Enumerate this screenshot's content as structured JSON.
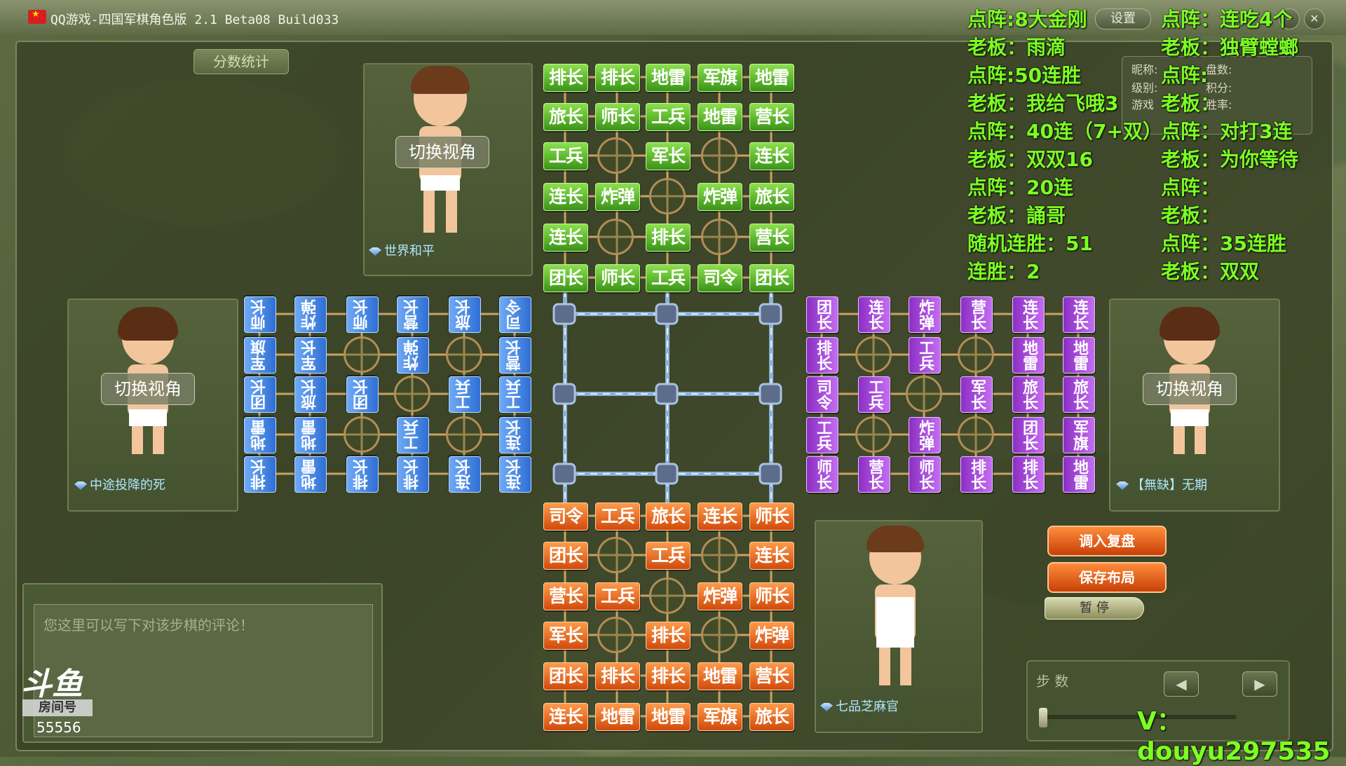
{
  "window": {
    "title": "QQ游戏-四国军棋角色版 2.1 Beta08 Build033",
    "settings_label": "设置",
    "minimize": "–",
    "close": "✕"
  },
  "score_button": "分数统计",
  "switch_label": "切换视角",
  "players": {
    "top": "世界和平",
    "left": "中途投降的死",
    "right": "【無缺】无期",
    "bottom": "七品芝麻官"
  },
  "stats_labels": {
    "nickname": "昵称:",
    "level": "级别:",
    "games": "游戏",
    "rounds": "盘数:",
    "points": "积分:",
    "winrate": "胜率:"
  },
  "overlay_left": [
    "点阵:8大金刚",
    "老板：雨滴",
    "点阵:50连胜",
    "老板：我给飞哦3",
    "点阵：40连（7+双）",
    "老板：双双16",
    "点阵：20连",
    "老板：誦哥",
    "随机连胜：51",
    "连胜：2"
  ],
  "overlay_right": [
    "点阵：连吃4个",
    "老板：独臂螳螂",
    "点阵:",
    "老板：",
    "点阵：对打3连",
    "老板：为你等待",
    "点阵：",
    "老板：",
    "点阵：35连胜",
    "老板：双双"
  ],
  "top_pieces": [
    [
      "排长",
      "排长",
      "地雷",
      "军旗",
      "地雷"
    ],
    [
      "旅长",
      "师长",
      "工兵",
      "地雷",
      "营长"
    ],
    [
      "工兵",
      "",
      "军长",
      "",
      "连长"
    ],
    [
      "连长",
      "炸弹",
      "",
      "炸弹",
      "旅长"
    ],
    [
      "连长",
      "",
      "排长",
      "",
      "营长"
    ],
    [
      "团长",
      "师长",
      "工兵",
      "司令",
      "团长"
    ]
  ],
  "bottom_pieces": [
    [
      "司令",
      "工兵",
      "旅长",
      "连长",
      "师长"
    ],
    [
      "团长",
      "",
      "工兵",
      "",
      "连长"
    ],
    [
      "营长",
      "工兵",
      "",
      "炸弹",
      "师长"
    ],
    [
      "军长",
      "",
      "排长",
      "",
      "炸弹"
    ],
    [
      "团长",
      "排长",
      "排长",
      "地雷",
      "营长"
    ],
    [
      "连长",
      "地雷",
      "地雷",
      "军旗",
      "旅长"
    ]
  ],
  "left_pieces": [
    [
      "师长",
      "炸弹",
      "师长",
      "营长",
      "旅长",
      "司令"
    ],
    [
      "军旗",
      "军长",
      "",
      "炸弹",
      "",
      "营长"
    ],
    [
      "团长",
      "旅长",
      "团长",
      "",
      "工兵",
      "工兵"
    ],
    [
      "地雷",
      "地雷",
      "",
      "工兵",
      "",
      "连长"
    ],
    [
      "排长",
      "地雷",
      "排长",
      "排长",
      "连长",
      "连长"
    ]
  ],
  "right_pieces": [
    [
      "团长",
      "连长",
      "炸弹",
      "营长",
      "连长",
      "连长"
    ],
    [
      "排长",
      "",
      "工兵",
      "",
      "地雷",
      "地雷"
    ],
    [
      "司令",
      "工兵",
      "",
      "军长",
      "旅长",
      "旅长"
    ],
    [
      "工兵",
      "",
      "炸弹",
      "",
      "团长",
      "军旗"
    ],
    [
      "师长",
      "营长",
      "师长",
      "排长",
      "排长",
      "地雷"
    ]
  ],
  "comment_placeholder": "您这里可以写下对该步棋的评论！",
  "buttons": {
    "load_replay": "调入复盘",
    "save_layout": "保存布局",
    "pause": "暂 停"
  },
  "steps_label": "步 数",
  "watermark": "V：douyu297535",
  "room": {
    "logo": "斗鱼",
    "label": "房间号",
    "number": "55556"
  },
  "colors": {
    "top_green": "#3b9418",
    "bottom_orange": "#d14b0c",
    "left_blue": "#2f6fd4",
    "right_purple": "#8c2fc4",
    "overlay_text": "#7dff24"
  }
}
